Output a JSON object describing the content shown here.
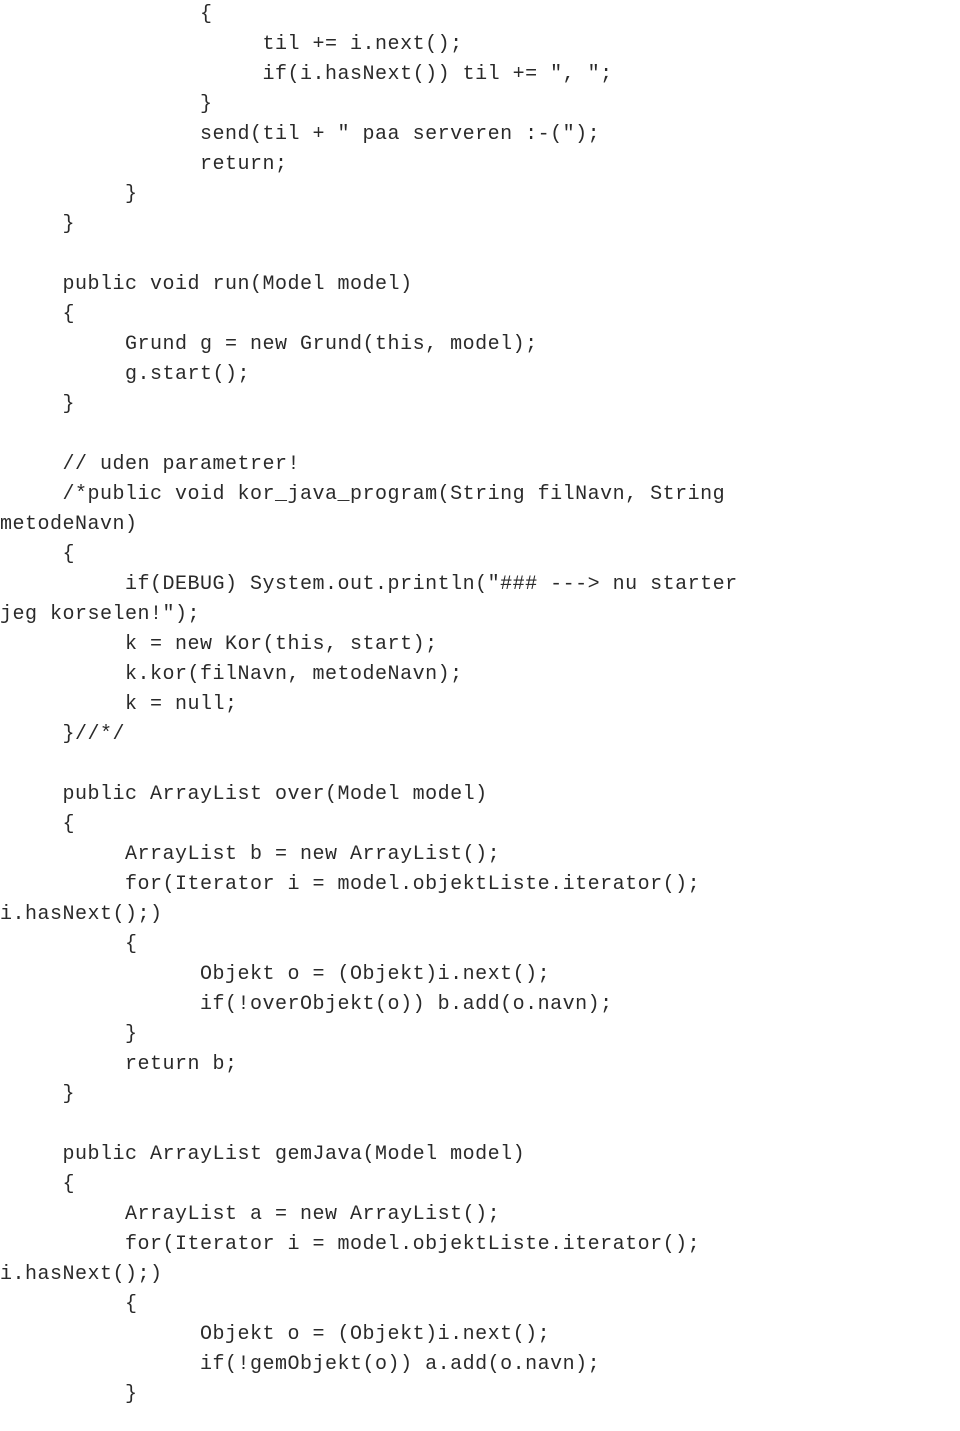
{
  "code": {
    "lines": [
      "                {",
      "                     til += i.next();",
      "                     if(i.hasNext()) til += \", \";",
      "                }",
      "                send(til + \" paa serveren :-(\");",
      "                return;",
      "          }",
      "     }",
      "",
      "     public void run(Model model)",
      "     {",
      "          Grund g = new Grund(this, model);",
      "          g.start();",
      "     }",
      "",
      "     // uden parametrer!",
      "     /*public void kor_java_program(String filNavn, String",
      "metodeNavn)",
      "     {",
      "          if(DEBUG) System.out.println(\"### ---> nu starter",
      "jeg korselen!\");",
      "          k = new Kor(this, start);",
      "          k.kor(filNavn, metodeNavn);",
      "          k = null;",
      "     }//*/",
      "",
      "     public ArrayList over(Model model)",
      "     {",
      "          ArrayList b = new ArrayList();",
      "          for(Iterator i = model.objektListe.iterator();",
      "i.hasNext();)",
      "          {",
      "                Objekt o = (Objekt)i.next();",
      "                if(!overObjekt(o)) b.add(o.navn);",
      "          }",
      "          return b;",
      "     }",
      "",
      "     public ArrayList gemJava(Model model)",
      "     {",
      "          ArrayList a = new ArrayList();",
      "          for(Iterator i = model.objektListe.iterator();",
      "i.hasNext();)",
      "          {",
      "                Objekt o = (Objekt)i.next();",
      "                if(!gemObjekt(o)) a.add(o.navn);",
      "          }"
    ]
  }
}
